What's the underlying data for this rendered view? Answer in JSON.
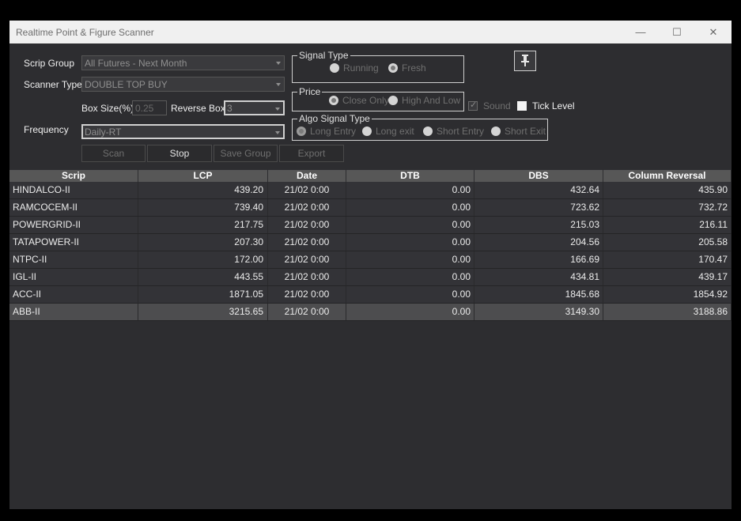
{
  "window": {
    "title": "Realtime Point & Figure Scanner",
    "controls": {
      "minimize": "—",
      "maximize": "☐",
      "close": "✕"
    }
  },
  "form": {
    "scrip_group_label": "Scrip Group",
    "scrip_group_value": "All Futures - Next Month",
    "scanner_type_label": "Scanner Type",
    "scanner_type_value": "DOUBLE TOP BUY",
    "box_size_label": "Box Size(%)",
    "box_size_value": "0.25",
    "reverse_box_label": "Reverse Box",
    "reverse_box_value": "3",
    "frequency_label": "Frequency",
    "frequency_value": "Daily-RT"
  },
  "signal_type": {
    "title": "Signal Type",
    "options": [
      "Running",
      "Fresh"
    ],
    "selected": "Fresh"
  },
  "price": {
    "title": "Price",
    "options": [
      "Close Only",
      "High And Low"
    ],
    "selected": "Close Only"
  },
  "algo_signal_type": {
    "title": "Algo Signal Type",
    "options": [
      "Long Entry",
      "Long exit",
      "Short Entry",
      "Short Exit"
    ],
    "selected": "Long Entry"
  },
  "sound": {
    "label": "Sound",
    "checked": true
  },
  "tick_level": {
    "label": "Tick Level",
    "checked": false
  },
  "pin": {
    "icon": "pin-icon"
  },
  "buttons": {
    "scan": "Scan",
    "stop": "Stop",
    "save_group": "Save Group",
    "export": "Export"
  },
  "table": {
    "columns": [
      "Scrip",
      "LCP",
      "Date",
      "DTB",
      "DBS",
      "Column Reversal"
    ],
    "rows": [
      [
        "HINDALCO-II",
        "439.20",
        "21/02 0:00",
        "0.00",
        "432.64",
        "435.90"
      ],
      [
        "RAMCOCEM-II",
        "739.40",
        "21/02 0:00",
        "0.00",
        "723.62",
        "732.72"
      ],
      [
        "POWERGRID-II",
        "217.75",
        "21/02 0:00",
        "0.00",
        "215.03",
        "216.11"
      ],
      [
        "TATAPOWER-II",
        "207.30",
        "21/02 0:00",
        "0.00",
        "204.56",
        "205.58"
      ],
      [
        "NTPC-II",
        "172.00",
        "21/02 0:00",
        "0.00",
        "166.69",
        "170.47"
      ],
      [
        "IGL-II",
        "443.55",
        "21/02 0:00",
        "0.00",
        "434.81",
        "439.17"
      ],
      [
        "ACC-II",
        "1871.05",
        "21/02 0:00",
        "0.00",
        "1845.68",
        "1854.92"
      ],
      [
        "ABB-II",
        "3215.65",
        "21/02 0:00",
        "0.00",
        "3149.30",
        "3188.86"
      ]
    ],
    "selected_row": 7
  },
  "colors": {
    "background": "#2d2d30",
    "header": "#575757",
    "selected_row": "#4d4d4f",
    "titlebar": "#f0f0f0"
  }
}
